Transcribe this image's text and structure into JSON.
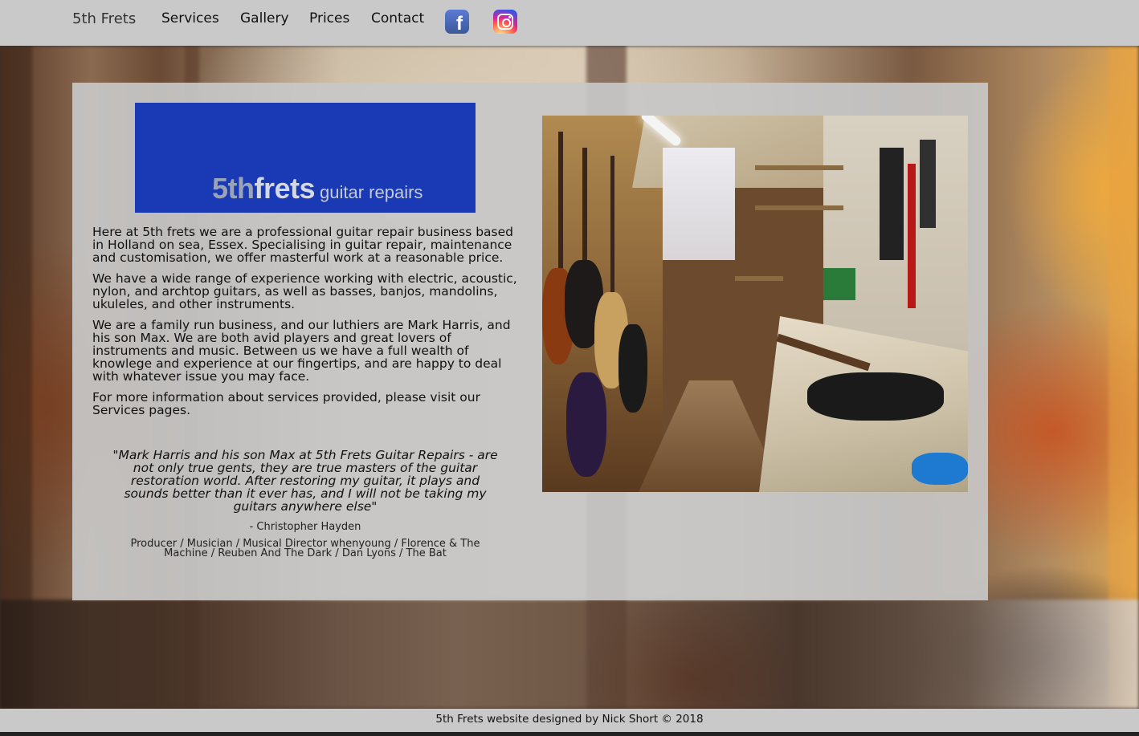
{
  "nav": {
    "brand": "5th Frets",
    "items": [
      {
        "label": "Services"
      },
      {
        "label": "Gallery"
      },
      {
        "label": "Prices"
      },
      {
        "label": "Contact"
      }
    ],
    "social": [
      {
        "icon": "facebook-icon",
        "glyph": "f"
      },
      {
        "icon": "instagram-icon"
      }
    ]
  },
  "logo": {
    "part1": "5th",
    "part2": "frets",
    "part3": "guitar repairs"
  },
  "intro": {
    "paragraphs": [
      "Here at 5th frets we are a professional guitar repair business based in Holland on sea, Essex. Specialising in guitar repair, maintenance and customisation, we offer masterful work at a reasonable price.",
      "We have a wide range of experience working with electric, acoustic, nylon, and archtop guitars, as well as basses, banjos, mandolins, ukuleles, and other instruments.",
      "We are a family run business, and our luthiers are Mark Harris, and his son Max. We are both avid players and great lovers of instruments and music. Between us we have a full wealth of knowlege and experience at our fingertips, and are happy to deal with whatever issue you may face.",
      "For more information about services provided, please visit our Services pages."
    ]
  },
  "testimonial": {
    "quote": "\"Mark Harris and his son Max at 5th Frets Guitar Repairs - are not only true gents, they are true masters of the guitar restoration world. After restoring my guitar, it plays and sounds better than it ever has, and I will not be taking my guitars anywhere else\"",
    "author": "- Christopher Hayden",
    "credits": "Producer / Musician / Musical Director whenyoung / Florence & The Machine / Reuben And The Dark / Dan Lyons / The Bat"
  },
  "footer": {
    "text": "5th Frets website designed by Nick Short © 2018"
  },
  "colors": {
    "nav_bg": "#c9c9c9",
    "logo_bg": "#1a3ab5"
  }
}
